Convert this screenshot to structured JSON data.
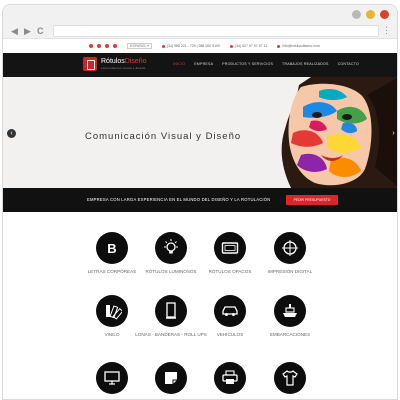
{
  "browser": {
    "dots": [
      "#b9b9b9",
      "#e5b532",
      "#d9422d"
    ],
    "back": "◀",
    "forward": "▶",
    "reload": "C",
    "menu": "⋮"
  },
  "topbar": {
    "lang": "ESPAÑOL ▾",
    "phone1": "(34) 988 221 - 729 | 988 000 9100",
    "phone2": "(34) 627 97 97 97 11",
    "email": "info@rotulosdiseno.com"
  },
  "logo": {
    "name_part1": "Rótulos",
    "name_part2": "Diseño",
    "tagline": "comunicacion visual y diseño"
  },
  "menu": [
    "INICIO",
    "EMPRESA",
    "PRODUCTOS Y SERVICIOS",
    "TRABAJOS REALIZADOS",
    "CONTACTO"
  ],
  "hero": {
    "title": "Comunicación Visual y Diseño",
    "prev": "‹",
    "next": "›"
  },
  "banner": {
    "text": "EMPRESA CON LARGA EXPERIENCIA EN EL MUNDO DEL DISEÑO Y LA ROTULACIÓN",
    "button": "PEDIR PRESUPUESTO"
  },
  "services": [
    {
      "label": "LETRAS CORPÓREAS",
      "icon": "letter-b-icon"
    },
    {
      "label": "RÓTULOS LUMINOSOS",
      "icon": "lightbulb-icon"
    },
    {
      "label": "RÓTULOS OPACOS",
      "icon": "sign-board-icon"
    },
    {
      "label": "IMPRESIÓN DIGITAL",
      "icon": "crosshair-icon"
    },
    {
      "label": "VINILO",
      "icon": "swatch-fan-icon"
    },
    {
      "label": "LONAS - BANDERAS - ROLL UPS",
      "icon": "rollup-banner-icon"
    },
    {
      "label": "VEHÍCULOS",
      "icon": "car-icon"
    },
    {
      "label": "EMBARCACIONES",
      "icon": "ship-icon"
    },
    {
      "label": "",
      "icon": "monitor-icon"
    },
    {
      "label": "",
      "icon": "sticker-icon"
    },
    {
      "label": "",
      "icon": "printer-icon"
    },
    {
      "label": "",
      "icon": "tshirt-icon"
    }
  ]
}
